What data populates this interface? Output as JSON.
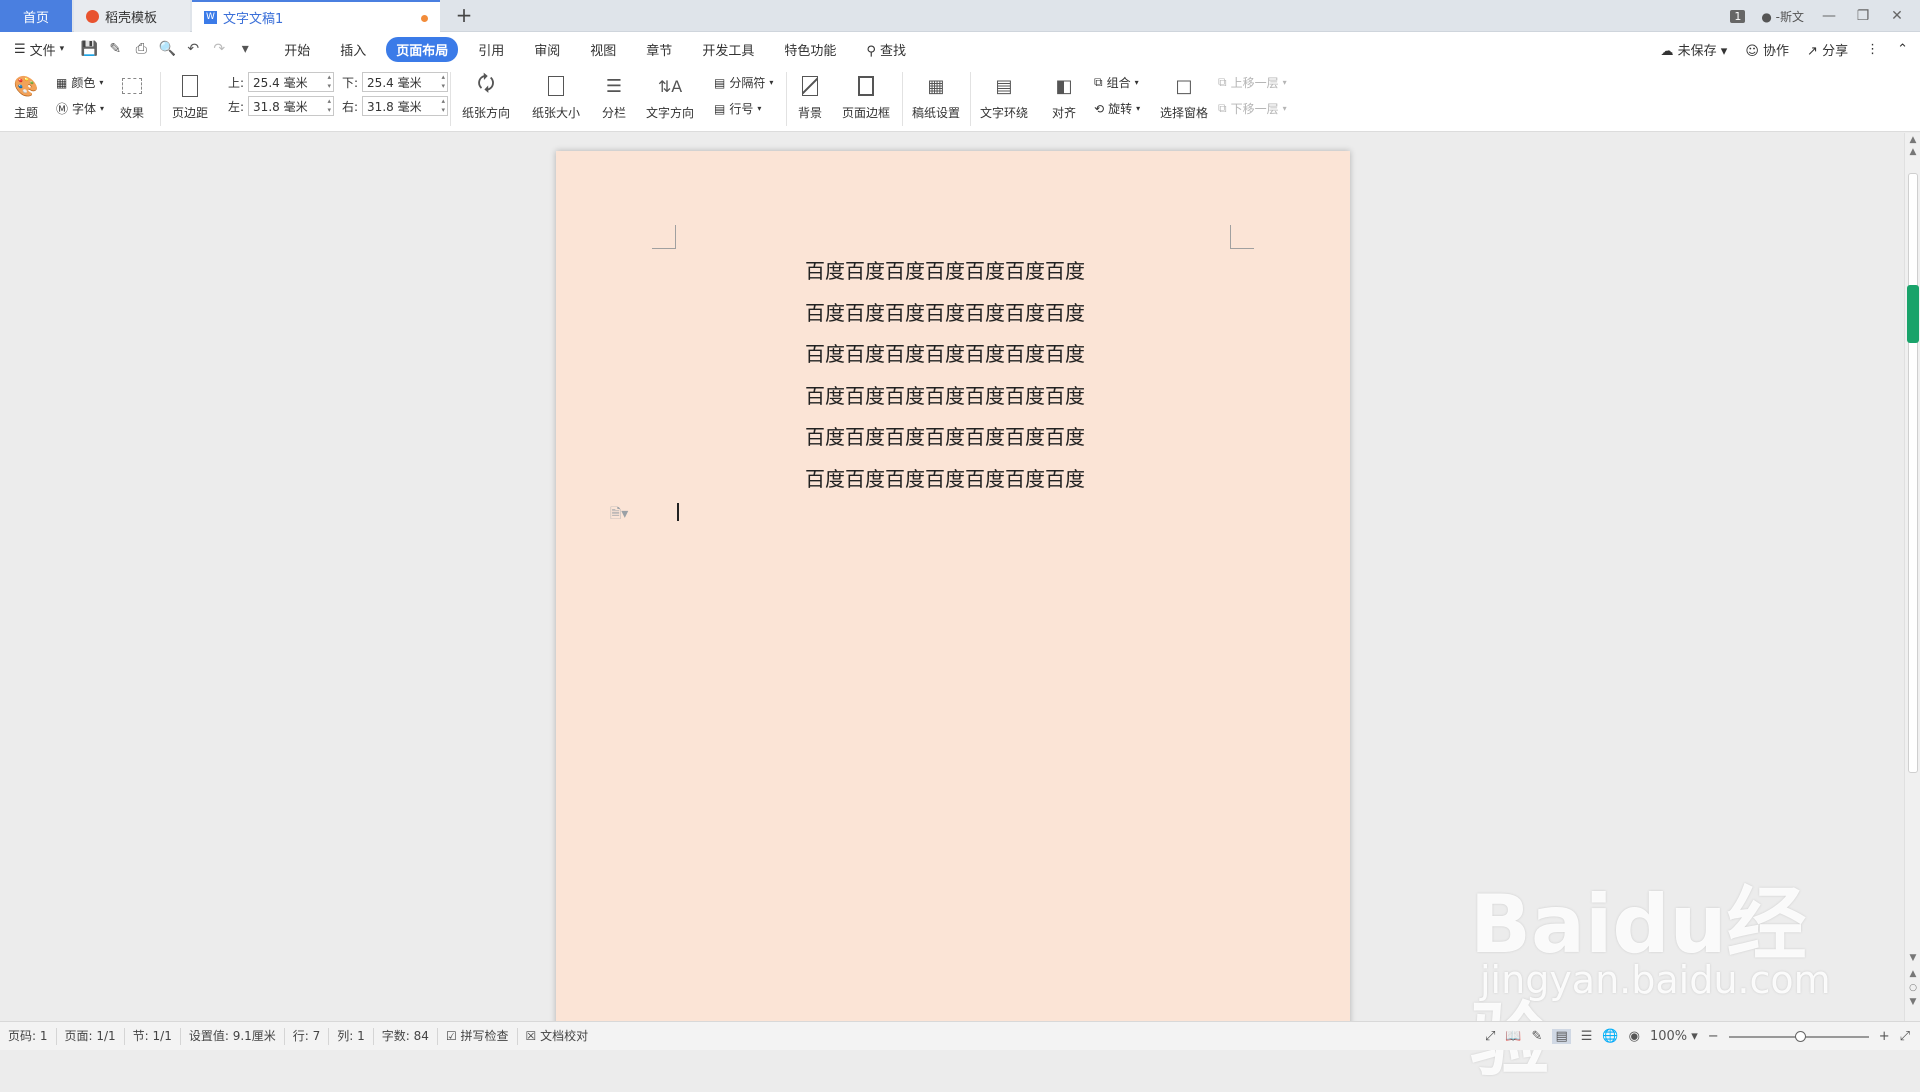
{
  "tabs": {
    "home": "首页",
    "template": "稻壳模板",
    "document": "文字文稿1",
    "new_tab": "+"
  },
  "titlebar": {
    "badge": "1",
    "user": "-斯文"
  },
  "menu": {
    "file": "文件",
    "items": [
      "开始",
      "插入",
      "页面布局",
      "引用",
      "审阅",
      "视图",
      "章节",
      "开发工具",
      "特色功能"
    ],
    "active": "页面布局",
    "search": "查找",
    "unsaved": "未保存",
    "collaborate": "协作",
    "share": "分享"
  },
  "ribbon": {
    "theme": "主题",
    "color": "颜色",
    "font": "字体",
    "effect": "效果",
    "margins": "页边距",
    "top_label": "上:",
    "top_value": "25.4 毫米",
    "bottom_label": "下:",
    "bottom_value": "25.4 毫米",
    "left_label": "左:",
    "left_value": "31.8 毫米",
    "right_label": "右:",
    "right_value": "31.8 毫米",
    "orientation": "纸张方向",
    "size": "纸张大小",
    "columns": "分栏",
    "text_direction": "文字方向",
    "separator": "分隔符",
    "line_number": "行号",
    "background": "背景",
    "page_border": "页面边框",
    "manuscript": "稿纸设置",
    "wrap": "文字环绕",
    "align": "对齐",
    "group": "组合",
    "rotate": "旋转",
    "selection_pane": "选择窗格",
    "bring_forward": "上移一层",
    "send_backward": "下移一层"
  },
  "document": {
    "lines": [
      "百度百度百度百度百度百度百度",
      "百度百度百度百度百度百度百度",
      "百度百度百度百度百度百度百度",
      "百度百度百度百度百度百度百度",
      "百度百度百度百度百度百度百度",
      "百度百度百度百度百度百度百度"
    ],
    "page_color": "#fbe4d6"
  },
  "watermark": {
    "logo": "Baidu经验",
    "url": "jingyan.baidu.com"
  },
  "status": {
    "page_num": "页码: 1",
    "pages": "页面: 1/1",
    "section": "节: 1/1",
    "setting": "设置值: 9.1厘米",
    "row": "行: 7",
    "col": "列: 1",
    "words": "字数: 84",
    "spell": "拼写检查",
    "proof": "文档校对",
    "zoom": "100%"
  },
  "colors": {
    "accent": "#3b7be8",
    "scroll_marker": "#19a36a"
  }
}
